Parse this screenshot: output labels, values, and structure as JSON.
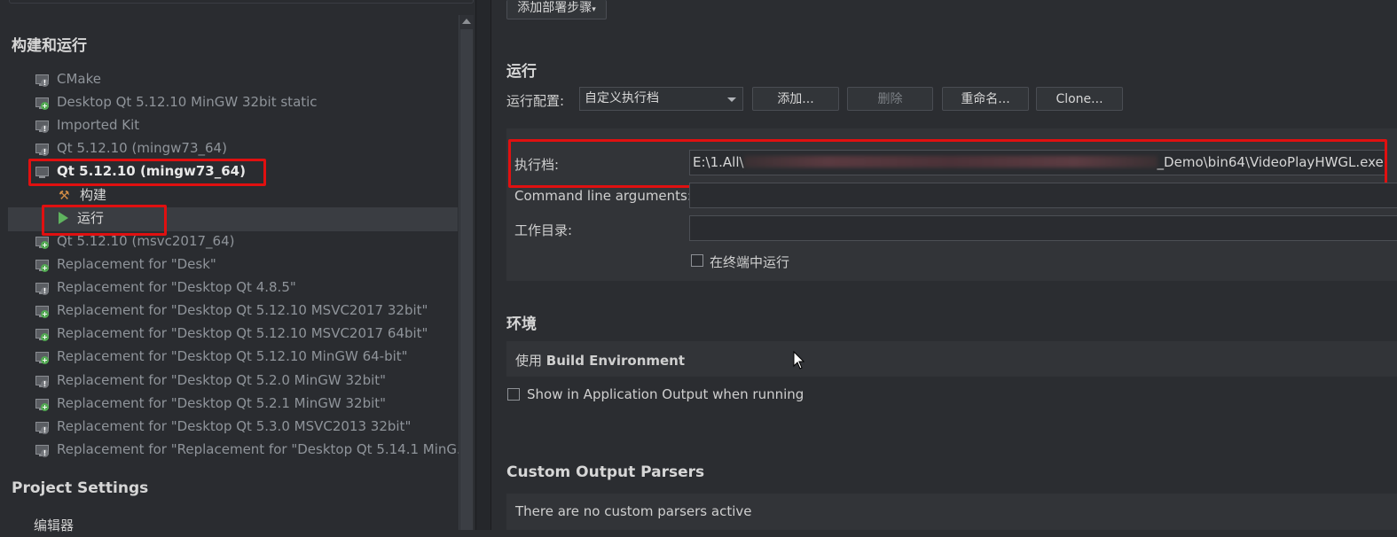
{
  "sidebar": {
    "section_build_run": "构建和运行",
    "kits": [
      {
        "label": "CMake",
        "badge": "grey"
      },
      {
        "label": "Desktop Qt 5.12.10 MinGW 32bit static",
        "badge": "green"
      },
      {
        "label": "Imported Kit",
        "badge": "grey"
      },
      {
        "label": "Qt 5.12.10 (mingw73_64)",
        "badge": "grey"
      },
      {
        "label": "Qt 5.12.10 (mingw73_64)",
        "badge": "none",
        "active": true
      },
      {
        "label": "Qt 5.12.10 (msvc2017_64)",
        "badge": "green"
      },
      {
        "label": "Replacement for \"Desk\"",
        "badge": "green"
      },
      {
        "label": "Replacement for \"Desktop Qt 4.8.5\"",
        "badge": "grey"
      },
      {
        "label": "Replacement for \"Desktop Qt 5.12.10 MSVC2017 32bit\"",
        "badge": "green"
      },
      {
        "label": "Replacement for \"Desktop Qt 5.12.10 MSVC2017 64bit\"",
        "badge": "green"
      },
      {
        "label": "Replacement for \"Desktop Qt 5.12.10 MinGW 64-bit\"",
        "badge": "green"
      },
      {
        "label": "Replacement for \"Desktop Qt 5.2.0 MinGW 32bit\"",
        "badge": "grey"
      },
      {
        "label": "Replacement for \"Desktop Qt 5.2.1 MinGW 32bit\"",
        "badge": "green"
      },
      {
        "label": "Replacement for \"Desktop Qt 5.3.0 MSVC2013 32bit\"",
        "badge": "grey"
      },
      {
        "label": "Replacement for \"Replacement for \"Desktop Qt 5.14.1 MinG...",
        "badge": "grey"
      }
    ],
    "build_label": "构建",
    "run_label": "运行",
    "section_project_settings": "Project Settings",
    "editor_label": "编辑器"
  },
  "toolbar": {
    "add_deploy_step": "添加部署步骤"
  },
  "run": {
    "title": "运行",
    "config_label": "运行配置:",
    "config_value": "自定义执行档",
    "add_btn": "添加...",
    "delete_btn": "删除",
    "rename_btn": "重命名...",
    "clone_btn": "Clone...",
    "exec_label": "执行档:",
    "exec_prefix": "E:\\1.All\\",
    "exec_suffix": "_Demo\\bin64\\VideoPlayHWGL.exe",
    "args_label": "Command line arguments:",
    "workdir_label": "工作目录:",
    "terminal_label": "在终端中运行"
  },
  "env": {
    "title": "环境",
    "use_prefix": "使用",
    "use_value": "Build Environment",
    "show_output_label": "Show in Application Output when running"
  },
  "parsers": {
    "title": "Custom Output Parsers",
    "none_text": "There are no custom parsers active"
  }
}
